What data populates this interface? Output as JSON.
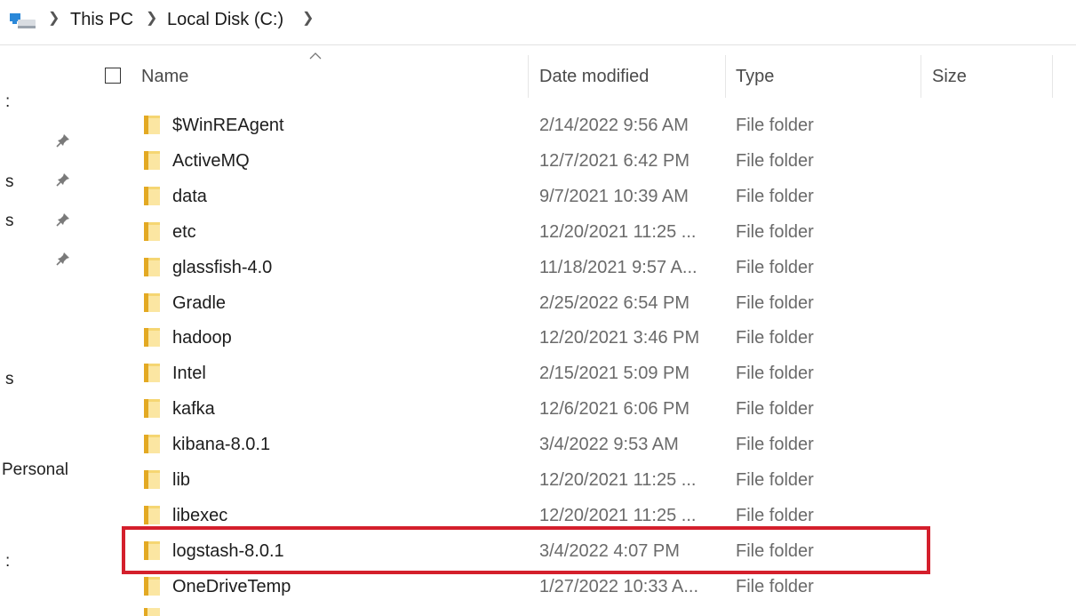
{
  "breadcrumb": {
    "items": [
      "This PC",
      "Local Disk (C:)"
    ],
    "separator": ">"
  },
  "nav_fragments": [
    ":",
    "s",
    "s",
    "s",
    "Personal",
    ":"
  ],
  "columns": {
    "name": "Name",
    "date_modified": "Date modified",
    "type": "Type",
    "size": "Size"
  },
  "files": [
    {
      "name": "$WinREAgent",
      "date": "2/14/2022 9:56 AM",
      "type": "File folder"
    },
    {
      "name": "ActiveMQ",
      "date": "12/7/2021 6:42 PM",
      "type": "File folder"
    },
    {
      "name": "data",
      "date": "9/7/2021 10:39 AM",
      "type": "File folder"
    },
    {
      "name": "etc",
      "date": "12/20/2021 11:25 ...",
      "type": "File folder"
    },
    {
      "name": "glassfish-4.0",
      "date": "11/18/2021 9:57 A...",
      "type": "File folder"
    },
    {
      "name": "Gradle",
      "date": "2/25/2022 6:54 PM",
      "type": "File folder"
    },
    {
      "name": "hadoop",
      "date": "12/20/2021 3:46 PM",
      "type": "File folder"
    },
    {
      "name": "Intel",
      "date": "2/15/2021 5:09 PM",
      "type": "File folder"
    },
    {
      "name": "kafka",
      "date": "12/6/2021 6:06 PM",
      "type": "File folder"
    },
    {
      "name": "kibana-8.0.1",
      "date": "3/4/2022 9:53 AM",
      "type": "File folder"
    },
    {
      "name": "lib",
      "date": "12/20/2021 11:25 ...",
      "type": "File folder"
    },
    {
      "name": "libexec",
      "date": "12/20/2021 11:25 ...",
      "type": "File folder"
    },
    {
      "name": "logstash-8.0.1",
      "date": "3/4/2022 4:07 PM",
      "type": "File folder"
    },
    {
      "name": "OneDriveTemp",
      "date": "1/27/2022 10:33 A...",
      "type": "File folder"
    }
  ],
  "highlighted_item": "logstash-8.0.1",
  "colors": {
    "highlight_border": "#d41f2c",
    "folder_yellow": "#f6c94e",
    "folder_light": "#fde9a6"
  },
  "icons": [
    "this-pc-icon",
    "chevron-right-icon",
    "sort-up-icon",
    "pin-icon",
    "folder-icon"
  ]
}
